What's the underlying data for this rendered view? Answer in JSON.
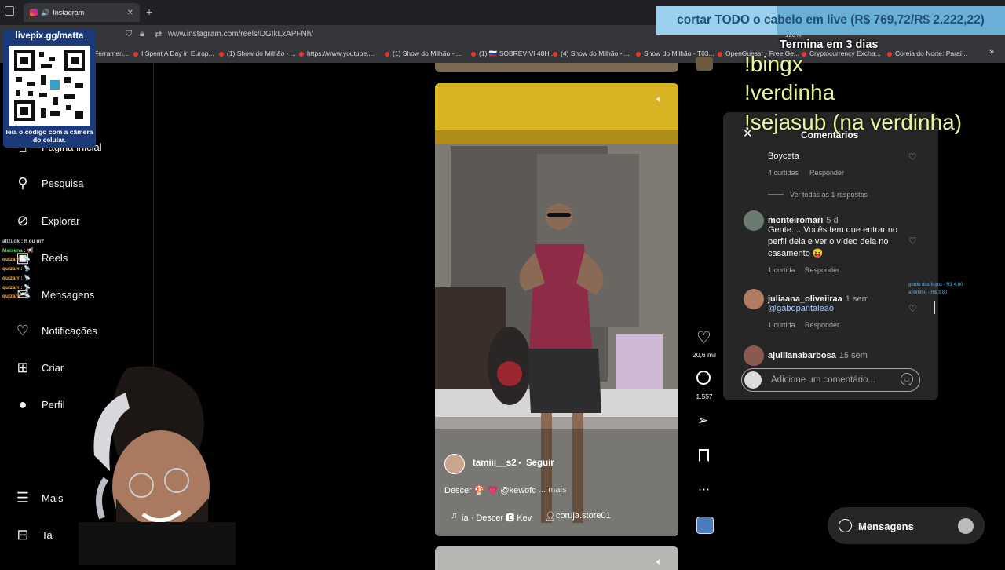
{
  "browser": {
    "tab_title": "Instagram",
    "url": "www.instagram.com/reels/DGIkLxAPFNh/",
    "zoom": "120%",
    "bookmarks": [
      "Ferramen...",
      "I Spent A Day in Europ...",
      "(1) Show do Milhão - ...",
      "https://www.youtube....",
      "(1) Show do Milhão - ...",
      "(1) 🇷🇺 SOBREVIVI 48H ...",
      "(4) Show do Milhão - ...",
      "Show do Milhão - T03...",
      "OpenGuessr - Free Ge...",
      "Cryptocurrency Excha...",
      "Coreia do Norte: Paraí..."
    ]
  },
  "overlay": {
    "livepix_title": "livepix.gg/matta",
    "qr_caption": "leia o código com a câmera do celular.",
    "goal_text": "cortar TODO o cabelo em live (R$ 769,72/R$ 2.222,22)",
    "goal_progress": 0.346,
    "goal_colors": {
      "fill": "#9bd0ee",
      "bar": "#6ab0d6",
      "text": "#1d4f79"
    },
    "ends": "Termina em 3 dias",
    "commands": [
      "!bingx",
      "!verdinha",
      "!sejasub (na verdinha)"
    ],
    "donations": [
      "gordo dos fogos - R$ 4,80",
      "anônimo - R$ 3,80"
    ]
  },
  "sidebar": {
    "items": [
      {
        "label": "Página inicial",
        "icon": "home-icon"
      },
      {
        "label": "Pesquisa",
        "icon": "search-icon"
      },
      {
        "label": "Explorar",
        "icon": "compass-icon"
      },
      {
        "label": "Reels",
        "icon": "reels-icon"
      },
      {
        "label": "Mensagens",
        "icon": "messenger-icon"
      },
      {
        "label": "Notificações",
        "icon": "heart-icon"
      },
      {
        "label": "Criar",
        "icon": "plus-square-icon"
      },
      {
        "label": "Perfil",
        "icon": "profile-icon"
      },
      {
        "label": "Mais",
        "icon": "menu-icon"
      },
      {
        "label": "Ta",
        "icon": "threads-icon"
      }
    ]
  },
  "chat": [
    {
      "user": "allzuok",
      "text": "h ou m?"
    },
    {
      "user": "Maisena",
      "text": "📢"
    },
    {
      "user": "quizarr",
      "text": "📡"
    },
    {
      "user": "quizarr",
      "text": "📡"
    },
    {
      "user": "quizarr",
      "text": "📡"
    },
    {
      "user": "quizarr",
      "text": "📡"
    },
    {
      "user": "quizarr",
      "text": "📡"
    }
  ],
  "reel": {
    "username": "tamiii__s2",
    "follow_label": "Seguir",
    "caption": "Descer 🍄 💗 @kewofc",
    "more_label": "... mais",
    "audio": "ia · Descer 🅴 Kev",
    "location": "coruja.store01",
    "likes": "20,6 mil",
    "comments_count": "1.557"
  },
  "comments_panel": {
    "title": "Comentários",
    "first": {
      "text": "Boyceta",
      "meta": [
        "4 curtidas",
        "Responder"
      ]
    },
    "view_replies": "Ver todas as 1 respostas",
    "items": [
      {
        "user": "monteiromari",
        "time": "5 d",
        "text": "Gente.... Vocês tem que entrar no perfil dela e ver o vídeo dela no casamento 😝",
        "meta": [
          "1 curtida",
          "Responder"
        ],
        "avatar_color": "#6b7b72"
      },
      {
        "user": "juliaana_oliveiiraa",
        "time": "1 sem",
        "text": "@gabopantaleao",
        "meta": [
          "1 curtida",
          "Responder"
        ],
        "avatar_color": "#b07a63"
      },
      {
        "user": "ajullianabarbosa",
        "time": "15 sem",
        "text": "",
        "meta": [],
        "avatar_color": "#8a5a50"
      }
    ],
    "add_placeholder": "Adicione um comentário..."
  },
  "messages_pill": {
    "label": "Mensagens"
  }
}
